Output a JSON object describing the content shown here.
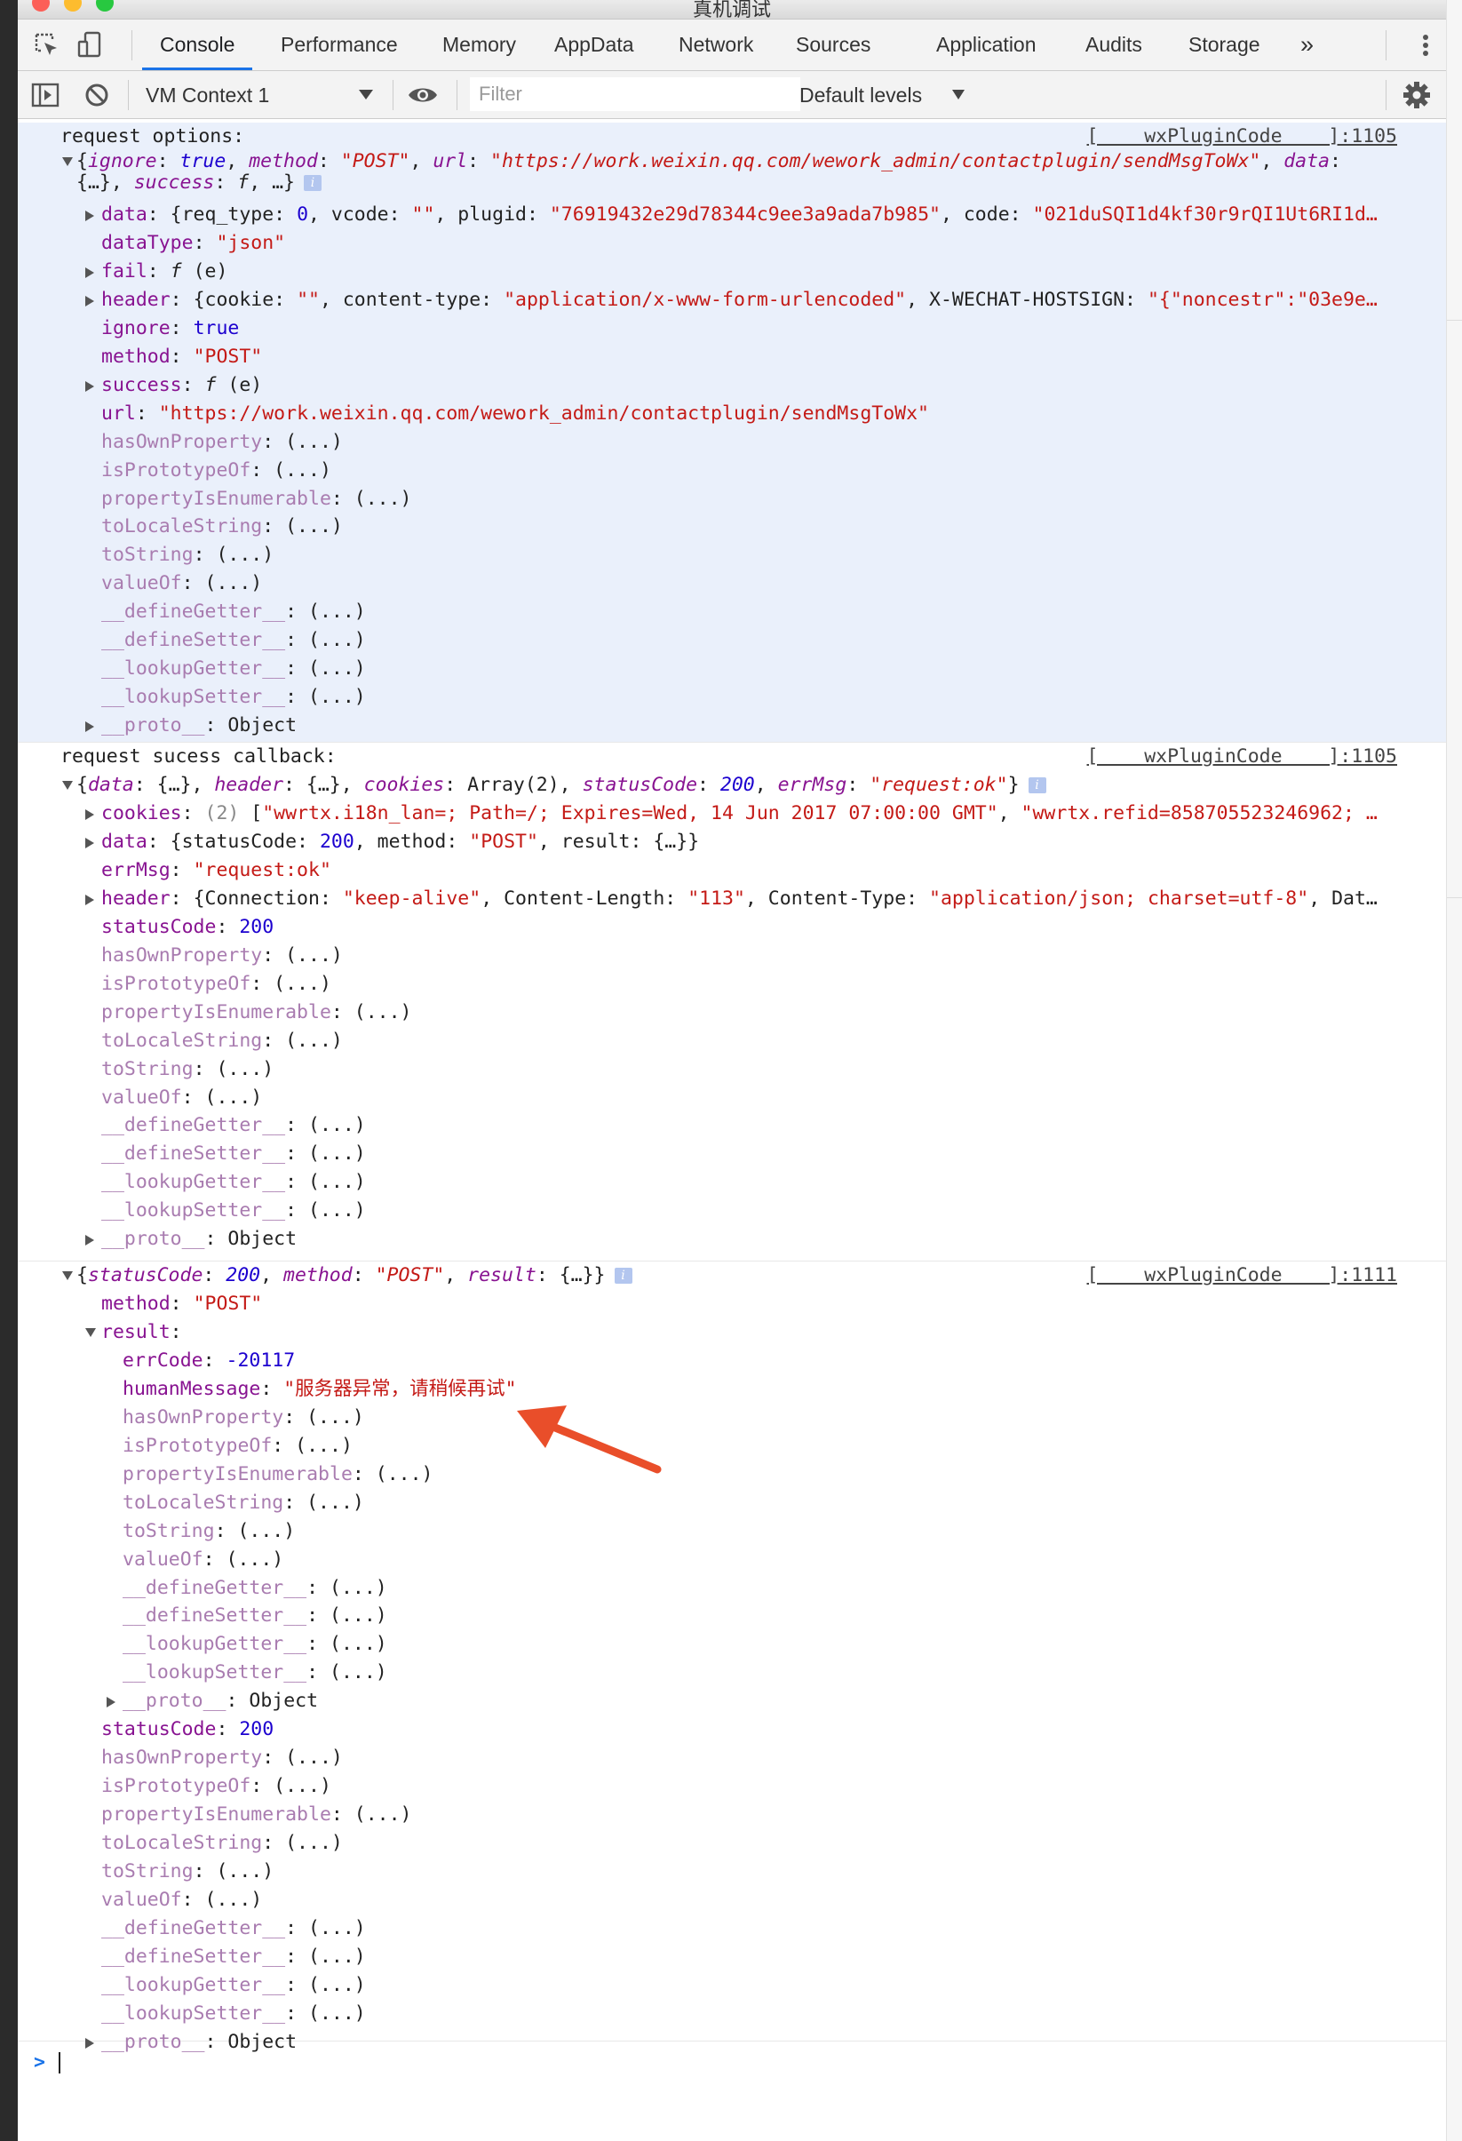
{
  "window": {
    "title": "真机调试"
  },
  "tabs": [
    {
      "label": "Console",
      "active": true
    },
    {
      "label": "Performance"
    },
    {
      "label": "Memory"
    },
    {
      "label": "AppData"
    },
    {
      "label": "Network"
    },
    {
      "label": "Sources"
    },
    {
      "label": "Application"
    },
    {
      "label": "Audits"
    },
    {
      "label": "Storage"
    }
  ],
  "more_tabs": "»",
  "toolbar": {
    "context": "VM Context 1",
    "filter_placeholder": "Filter",
    "levels": "Default levels"
  },
  "icons": {
    "inspect": "inspect-element-icon",
    "device": "device-toolbar-icon",
    "sidebar": "sidebar-toggle-icon",
    "clear": "clear-console-icon",
    "eye": "eye-icon",
    "settings": "gear-icon",
    "more": "kebab-menu-icon"
  },
  "colors": {
    "accent": "#1a73e8",
    "highlight_bg": "#eaf0fb",
    "key": "#881391",
    "string": "#c41a16",
    "number": "#1c00cf",
    "annotation_arrow": "#e94e2a"
  },
  "console": {
    "messages": [
      {
        "label": "request options:",
        "source": "[    wxPluginCode    ]:1105",
        "summary": [
          [
            "p",
            "{"
          ],
          [
            "ki",
            "ignore"
          ],
          [
            "p",
            ": "
          ],
          [
            "ni",
            "true"
          ],
          [
            "p",
            ", "
          ],
          [
            "ki",
            "method"
          ],
          [
            "p",
            ": "
          ],
          [
            "si",
            "\"POST\""
          ],
          [
            "p",
            ", "
          ],
          [
            "ki",
            "url"
          ],
          [
            "p",
            ": "
          ],
          [
            "si",
            "\"https://work.weixin.qq.com/wework_admin/contactplugin/sendMsgToWx\""
          ],
          [
            "p",
            ", "
          ],
          [
            "ki",
            "data"
          ],
          [
            "p",
            ":"
          ]
        ],
        "summary2": [
          [
            "p",
            "{…}, "
          ],
          [
            "ki",
            "success"
          ],
          [
            "p",
            ": "
          ],
          [
            "pi",
            "f"
          ],
          [
            "p",
            ", …}"
          ]
        ],
        "props": [
          {
            "key": "data",
            "exp": "closed",
            "val": [
              [
                "p",
                "{req_type: "
              ],
              [
                "n",
                "0"
              ],
              [
                "p",
                ", vcode: "
              ],
              [
                "s",
                "\"\""
              ],
              [
                "p",
                ", plugid: "
              ],
              [
                "s",
                "\"76919432e29d78344c9ee3a9ada7b985\""
              ],
              [
                "p",
                ", code: "
              ],
              [
                "s",
                "\"021duSQI1d4kf30r9rQI1Ut6RI1d…"
              ]
            ]
          },
          {
            "key": "dataType",
            "val": [
              [
                "s",
                "\"json\""
              ]
            ]
          },
          {
            "key": "fail",
            "exp": "closed",
            "val": [
              [
                "pi",
                "f"
              ],
              [
                "p",
                " (e)"
              ]
            ]
          },
          {
            "key": "header",
            "exp": "closed",
            "val": [
              [
                "p",
                "{cookie: "
              ],
              [
                "s",
                "\"\""
              ],
              [
                "p",
                ", content-type: "
              ],
              [
                "s",
                "\"application/x-www-form-urlencoded\""
              ],
              [
                "p",
                ", X-WECHAT-HOSTSIGN: "
              ],
              [
                "s",
                "\"{\"noncestr\":\"03e9e…"
              ]
            ]
          },
          {
            "key": "ignore",
            "val": [
              [
                "n",
                "true"
              ]
            ]
          },
          {
            "key": "method",
            "val": [
              [
                "s",
                "\"POST\""
              ]
            ]
          },
          {
            "key": "success",
            "exp": "closed",
            "val": [
              [
                "pi",
                "f"
              ],
              [
                "p",
                " (e)"
              ]
            ]
          },
          {
            "key": "url",
            "val": [
              [
                "s",
                "\"https://work.weixin.qq.com/wework_admin/contactplugin/sendMsgToWx\""
              ]
            ]
          },
          {
            "key": "hasOwnProperty",
            "dim": true,
            "val": [
              [
                "p",
                "(...)"
              ]
            ]
          },
          {
            "key": "isPrototypeOf",
            "dim": true,
            "val": [
              [
                "p",
                "(...)"
              ]
            ]
          },
          {
            "key": "propertyIsEnumerable",
            "dim": true,
            "val": [
              [
                "p",
                "(...)"
              ]
            ]
          },
          {
            "key": "toLocaleString",
            "dim": true,
            "val": [
              [
                "p",
                "(...)"
              ]
            ]
          },
          {
            "key": "toString",
            "dim": true,
            "val": [
              [
                "p",
                "(...)"
              ]
            ]
          },
          {
            "key": "valueOf",
            "dim": true,
            "val": [
              [
                "p",
                "(...)"
              ]
            ]
          },
          {
            "key": "__defineGetter__",
            "dim": true,
            "val": [
              [
                "p",
                "(...)"
              ]
            ]
          },
          {
            "key": "__defineSetter__",
            "dim": true,
            "val": [
              [
                "p",
                "(...)"
              ]
            ]
          },
          {
            "key": "__lookupGetter__",
            "dim": true,
            "val": [
              [
                "p",
                "(...)"
              ]
            ]
          },
          {
            "key": "__lookupSetter__",
            "dim": true,
            "val": [
              [
                "p",
                "(...)"
              ]
            ]
          },
          {
            "key": "__proto__",
            "dim": true,
            "exp": "closed",
            "val": [
              [
                "p",
                "Object"
              ]
            ]
          }
        ]
      },
      {
        "label": "request sucess callback:",
        "source": "[    wxPluginCode    ]:1105",
        "summary": [
          [
            "p",
            "{"
          ],
          [
            "ki",
            "data"
          ],
          [
            "p",
            ": {…}, "
          ],
          [
            "ki",
            "header"
          ],
          [
            "p",
            ": {…}, "
          ],
          [
            "ki",
            "cookies"
          ],
          [
            "p",
            ": Array(2), "
          ],
          [
            "ki",
            "statusCode"
          ],
          [
            "p",
            ": "
          ],
          [
            "ni",
            "200"
          ],
          [
            "p",
            ", "
          ],
          [
            "ki",
            "errMsg"
          ],
          [
            "p",
            ": "
          ],
          [
            "si",
            "\"request:ok\""
          ],
          [
            "p",
            "}"
          ]
        ],
        "props": [
          {
            "key": "cookies",
            "exp": "closed",
            "val": [
              [
                "g",
                "(2) "
              ],
              [
                "p",
                "["
              ],
              [
                "s",
                "\"wwrtx.i18n_lan=; Path=/; Expires=Wed, 14 Jun 2017 07:00:00 GMT\""
              ],
              [
                "p",
                ", "
              ],
              [
                "s",
                "\"wwrtx.refid=858705523246962; …"
              ]
            ]
          },
          {
            "key": "data",
            "exp": "closed",
            "val": [
              [
                "p",
                "{statusCode: "
              ],
              [
                "n",
                "200"
              ],
              [
                "p",
                ", method: "
              ],
              [
                "s",
                "\"POST\""
              ],
              [
                "p",
                ", result: {…}}"
              ]
            ]
          },
          {
            "key": "errMsg",
            "val": [
              [
                "s",
                "\"request:ok\""
              ]
            ]
          },
          {
            "key": "header",
            "exp": "closed",
            "val": [
              [
                "p",
                "{Connection: "
              ],
              [
                "s",
                "\"keep-alive\""
              ],
              [
                "p",
                ", Content-Length: "
              ],
              [
                "s",
                "\"113\""
              ],
              [
                "p",
                ", Content-Type: "
              ],
              [
                "s",
                "\"application/json; charset=utf-8\""
              ],
              [
                "p",
                ", Dat…"
              ]
            ]
          },
          {
            "key": "statusCode",
            "val": [
              [
                "n",
                "200"
              ]
            ]
          },
          {
            "key": "hasOwnProperty",
            "dim": true,
            "val": [
              [
                "p",
                "(...)"
              ]
            ]
          },
          {
            "key": "isPrototypeOf",
            "dim": true,
            "val": [
              [
                "p",
                "(...)"
              ]
            ]
          },
          {
            "key": "propertyIsEnumerable",
            "dim": true,
            "val": [
              [
                "p",
                "(...)"
              ]
            ]
          },
          {
            "key": "toLocaleString",
            "dim": true,
            "val": [
              [
                "p",
                "(...)"
              ]
            ]
          },
          {
            "key": "toString",
            "dim": true,
            "val": [
              [
                "p",
                "(...)"
              ]
            ]
          },
          {
            "key": "valueOf",
            "dim": true,
            "val": [
              [
                "p",
                "(...)"
              ]
            ]
          },
          {
            "key": "__defineGetter__",
            "dim": true,
            "val": [
              [
                "p",
                "(...)"
              ]
            ]
          },
          {
            "key": "__defineSetter__",
            "dim": true,
            "val": [
              [
                "p",
                "(...)"
              ]
            ]
          },
          {
            "key": "__lookupGetter__",
            "dim": true,
            "val": [
              [
                "p",
                "(...)"
              ]
            ]
          },
          {
            "key": "__lookupSetter__",
            "dim": true,
            "val": [
              [
                "p",
                "(...)"
              ]
            ]
          },
          {
            "key": "__proto__",
            "dim": true,
            "exp": "closed",
            "val": [
              [
                "p",
                "Object"
              ]
            ]
          }
        ]
      },
      {
        "label": "",
        "source": "[    wxPluginCode    ]:1111",
        "summary": [
          [
            "p",
            "{"
          ],
          [
            "ki",
            "statusCode"
          ],
          [
            "p",
            ": "
          ],
          [
            "ni",
            "200"
          ],
          [
            "p",
            ", "
          ],
          [
            "ki",
            "method"
          ],
          [
            "p",
            ": "
          ],
          [
            "si",
            "\"POST\""
          ],
          [
            "p",
            ", "
          ],
          [
            "ki",
            "result"
          ],
          [
            "p",
            ": {…}}"
          ]
        ],
        "props": [
          {
            "key": "method",
            "val": [
              [
                "s",
                "\"POST\""
              ]
            ]
          },
          {
            "key": "result",
            "exp": "open",
            "val": []
          },
          {
            "key": "errCode",
            "lvl": 2,
            "val": [
              [
                "n",
                "-20117"
              ]
            ]
          },
          {
            "key": "humanMessage",
            "lvl": 2,
            "val": [
              [
                "s",
                "\"服务器异常，请稍候再试\""
              ]
            ]
          },
          {
            "key": "hasOwnProperty",
            "lvl": 2,
            "dim": true,
            "val": [
              [
                "p",
                "(...)"
              ]
            ]
          },
          {
            "key": "isPrototypeOf",
            "lvl": 2,
            "dim": true,
            "val": [
              [
                "p",
                "(...)"
              ]
            ]
          },
          {
            "key": "propertyIsEnumerable",
            "lvl": 2,
            "dim": true,
            "val": [
              [
                "p",
                "(...)"
              ]
            ]
          },
          {
            "key": "toLocaleString",
            "lvl": 2,
            "dim": true,
            "val": [
              [
                "p",
                "(...)"
              ]
            ]
          },
          {
            "key": "toString",
            "lvl": 2,
            "dim": true,
            "val": [
              [
                "p",
                "(...)"
              ]
            ]
          },
          {
            "key": "valueOf",
            "lvl": 2,
            "dim": true,
            "val": [
              [
                "p",
                "(...)"
              ]
            ]
          },
          {
            "key": "__defineGetter__",
            "lvl": 2,
            "dim": true,
            "val": [
              [
                "p",
                "(...)"
              ]
            ]
          },
          {
            "key": "__defineSetter__",
            "lvl": 2,
            "dim": true,
            "val": [
              [
                "p",
                "(...)"
              ]
            ]
          },
          {
            "key": "__lookupGetter__",
            "lvl": 2,
            "dim": true,
            "val": [
              [
                "p",
                "(...)"
              ]
            ]
          },
          {
            "key": "__lookupSetter__",
            "lvl": 2,
            "dim": true,
            "val": [
              [
                "p",
                "(...)"
              ]
            ]
          },
          {
            "key": "__proto__",
            "lvl": 2,
            "dim": true,
            "exp": "closed",
            "val": [
              [
                "p",
                "Object"
              ]
            ]
          },
          {
            "key": "statusCode",
            "val": [
              [
                "n",
                "200"
              ]
            ]
          },
          {
            "key": "hasOwnProperty",
            "dim": true,
            "val": [
              [
                "p",
                "(...)"
              ]
            ]
          },
          {
            "key": "isPrototypeOf",
            "dim": true,
            "val": [
              [
                "p",
                "(...)"
              ]
            ]
          },
          {
            "key": "propertyIsEnumerable",
            "dim": true,
            "val": [
              [
                "p",
                "(...)"
              ]
            ]
          },
          {
            "key": "toLocaleString",
            "dim": true,
            "val": [
              [
                "p",
                "(...)"
              ]
            ]
          },
          {
            "key": "toString",
            "dim": true,
            "val": [
              [
                "p",
                "(...)"
              ]
            ]
          },
          {
            "key": "valueOf",
            "dim": true,
            "val": [
              [
                "p",
                "(...)"
              ]
            ]
          },
          {
            "key": "__defineGetter__",
            "dim": true,
            "val": [
              [
                "p",
                "(...)"
              ]
            ]
          },
          {
            "key": "__defineSetter__",
            "dim": true,
            "val": [
              [
                "p",
                "(...)"
              ]
            ]
          },
          {
            "key": "__lookupGetter__",
            "dim": true,
            "val": [
              [
                "p",
                "(...)"
              ]
            ]
          },
          {
            "key": "__lookupSetter__",
            "dim": true,
            "val": [
              [
                "p",
                "(...)"
              ]
            ]
          },
          {
            "key": "__proto__",
            "dim": true,
            "exp": "closed",
            "val": [
              [
                "p",
                "Object"
              ]
            ]
          }
        ]
      }
    ],
    "prompt": ">"
  }
}
